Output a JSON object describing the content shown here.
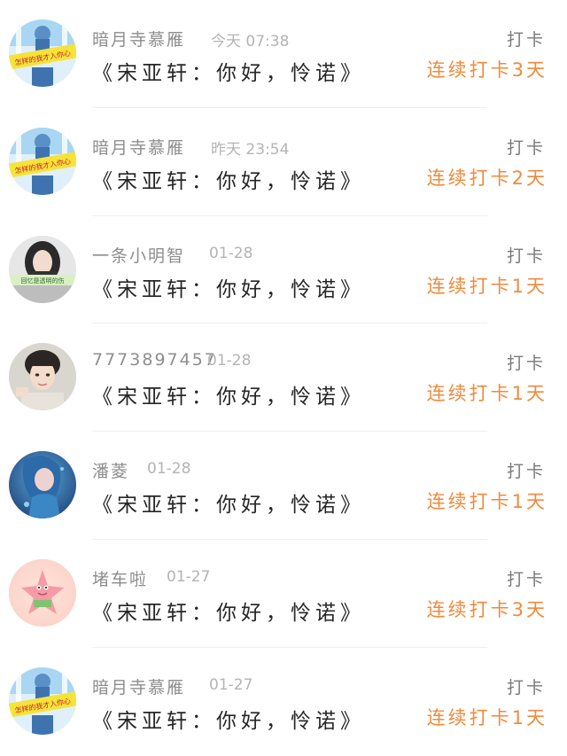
{
  "feed": {
    "items": [
      {
        "username": "暗月寺慕雁",
        "time": "今天 07:38",
        "content": "《宋亚轩：你好，怜诺》",
        "action": "打卡",
        "streak": "连续打卡3天",
        "avatar_icon": "anime-banner-avatar-icon",
        "avatar_text": "怎样的我才入你心"
      },
      {
        "username": "暗月寺慕雁",
        "time": "昨天 23:54",
        "content": "《宋亚轩：你好，怜诺》",
        "action": "打卡",
        "streak": "连续打卡2天",
        "avatar_icon": "anime-banner-avatar-icon",
        "avatar_text": "怎样的我才入你心"
      },
      {
        "username": "一条小明智",
        "time": "01-28",
        "content": "《宋亚轩：你好，怜诺》",
        "action": "打卡",
        "streak": "连续打卡1天",
        "avatar_icon": "portrait-banner-avatar-icon",
        "avatar_text": "回忆是透明的伤"
      },
      {
        "username": "7773897457",
        "time": "01-28",
        "content": "《宋亚轩：你好，怜诺》",
        "action": "打卡",
        "streak": "连续打卡1天",
        "avatar_icon": "boy-portrait-avatar-icon"
      },
      {
        "username": "潘菱",
        "time": "01-28",
        "content": "《宋亚轩：你好，怜诺》",
        "action": "打卡",
        "streak": "连续打卡1天",
        "avatar_icon": "mermaid-avatar-icon"
      },
      {
        "username": "堵车啦",
        "time": "01-27",
        "content": "《宋亚轩：你好，怜诺》",
        "action": "打卡",
        "streak": "连续打卡3天",
        "avatar_icon": "starfish-avatar-icon"
      },
      {
        "username": "暗月寺慕雁",
        "time": "01-27",
        "content": "《宋亚轩：你好，怜诺》",
        "action": "打卡",
        "streak": "连续打卡1天",
        "avatar_icon": "anime-banner-avatar-icon",
        "avatar_text": "怎样的我才入你心"
      }
    ]
  },
  "colors": {
    "streak": "#f08a3c",
    "username": "#8e8e8e",
    "time": "#b4b4b4",
    "content": "#262626"
  }
}
